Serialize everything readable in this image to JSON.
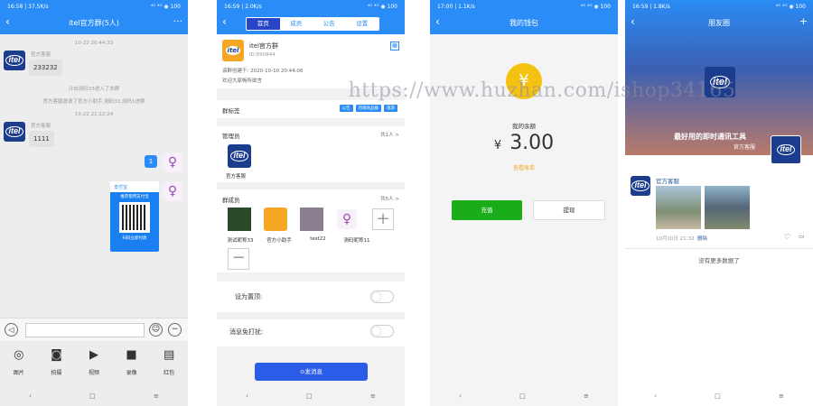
{
  "panel1": {
    "status_left": "16:58 | 37.5K/s",
    "status_right": "⁴ᴳ ⁴ᴳ ◉ 100",
    "title": "itel官方群(5人)",
    "time1": "10-22 20:44:33",
    "sender1": "官方客服",
    "msg1": "233232",
    "notice1": "计出测码33进入了本群",
    "notice2": "官方客服邀请了官方小助手,测码33,测码1进群",
    "time2": "10-22 21:22:24",
    "sender2": "官方客服",
    "msg2": "1111",
    "my_msg": "1",
    "card_brand": "支付宝",
    "card_title": "推荐使用支付宝",
    "card_footer": "扫码立即付款",
    "tools": [
      {
        "icon": "image-icon",
        "label": "图片"
      },
      {
        "icon": "camera-icon",
        "label": "拍摄"
      },
      {
        "icon": "video-icon",
        "label": "视频"
      },
      {
        "icon": "video-call-icon",
        "label": "录像"
      },
      {
        "icon": "red-packet-icon",
        "label": "红包"
      }
    ]
  },
  "panel2": {
    "status_left": "16:59 | 2.0K/s",
    "status_right": "⁴ᴳ ⁴ᴳ ◉ 100",
    "tabs": [
      "首页",
      "成员",
      "公告",
      "设置"
    ],
    "group_name": "itel官方群",
    "group_id": "ID:890844",
    "created": "该群创建于: 2020-10-10 20:44:06",
    "welcome": "欢迎大家畅所欲言",
    "tags_label": "群标签",
    "tags": [
      "公告",
      "热销商品群",
      "旅游"
    ],
    "admin_label": "管理员",
    "admin_count": "共1人 >",
    "admin_name": "官方客服",
    "members_label": "群成员",
    "members_count": "共5人 >",
    "members": [
      "测试昵称33",
      "官方小助手",
      "test22",
      "测码昵称11"
    ],
    "pin_label": "设为置顶:",
    "mute_label": "消息免打扰:",
    "send_button": "⊙发消息"
  },
  "panel3": {
    "status_left": "17:00 | 1.1K/s",
    "status_right": "⁴ᴳ ⁴ᴳ ◉ 100",
    "title": "我的钱包",
    "balance_label": "我的余额",
    "currency": "¥",
    "balance": "3.00",
    "detail_link": "查看账单",
    "recharge": "充值",
    "withdraw": "提现"
  },
  "panel4": {
    "status_left": "16:59 | 1.8K/s",
    "status_right": "⁴ᴳ ⁴ᴳ ◉ 100",
    "title": "朋友圈",
    "banner_text": "最好用的即时通讯工具",
    "banner_user": "官方客服",
    "post_user": "官方客服",
    "post_time": "10月10日 21:32",
    "post_delete": "删除",
    "no_more": "没有更多数据了"
  },
  "watermark": "https://www.huzhan.com/ishop34165",
  "colors": {
    "primary": "#2a8cf6",
    "green": "#1aad19",
    "orange": "#f5a623",
    "bubble": "#e2e2e2"
  }
}
